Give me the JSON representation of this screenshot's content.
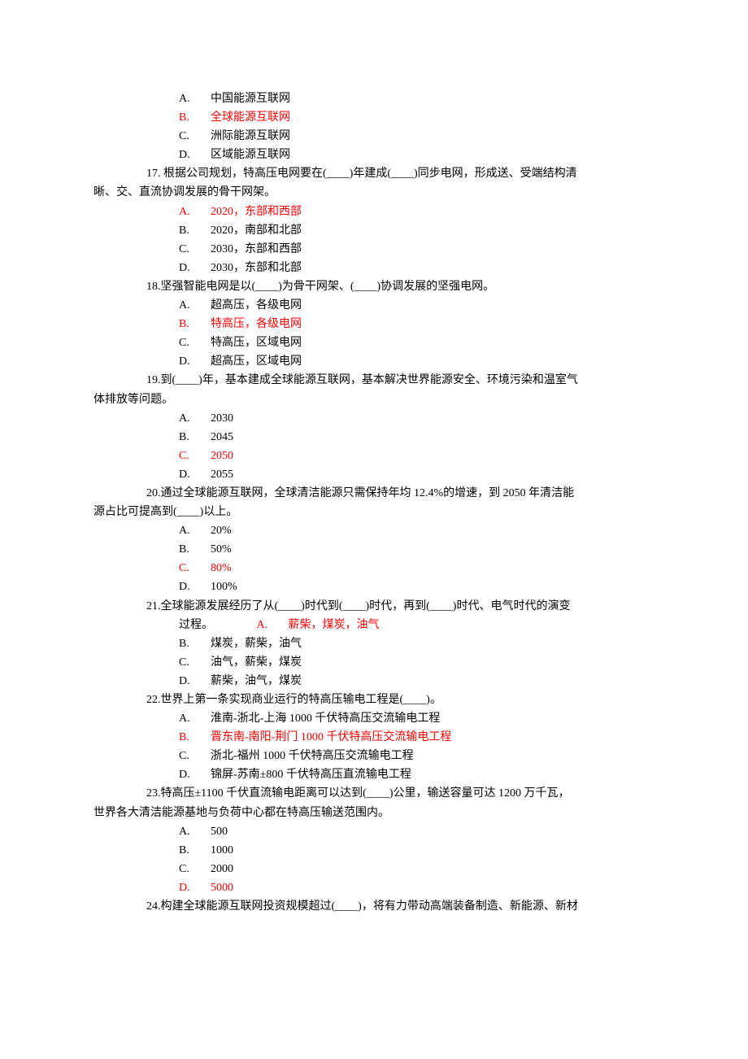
{
  "q16": {
    "a": {
      "letter": "A.",
      "text": "中国能源互联网"
    },
    "b": {
      "letter": "B.",
      "text": "全球能源互联网"
    },
    "c": {
      "letter": "C.",
      "text": "洲际能源互联网"
    },
    "d": {
      "letter": "D.",
      "text": "区域能源互联网"
    }
  },
  "q17": {
    "stem1": "17. 根据公司规划，特高压电网要在(____)年建成(____)同步电网，形成送、受端结构清",
    "stem2": "晰、交、直流协调发展的骨干网架。",
    "a": {
      "letter": "A.",
      "text": "2020，东部和西部"
    },
    "b": {
      "letter": "B.",
      "text": "2020，南部和北部"
    },
    "c": {
      "letter": "C.",
      "text": "2030，东部和西部"
    },
    "d": {
      "letter": "D.",
      "text": "2030，东部和北部"
    }
  },
  "q18": {
    "stem": "18.坚强智能电网是以(____)为骨干网架、(____)协调发展的坚强电网。",
    "a": {
      "letter": "A.",
      "text": "超高压，各级电网"
    },
    "b": {
      "letter": "B.",
      "text": "特高压，各级电网"
    },
    "c": {
      "letter": "C.",
      "text": "特高压，区域电网"
    },
    "d": {
      "letter": "D.",
      "text": "超高压，区域电网"
    }
  },
  "q19": {
    "stem1": "19.到(____)年，基本建成全球能源互联网，基本解决世界能源安全、环境污染和温室气",
    "stem2": "体排放等问题。",
    "a": {
      "letter": "A.",
      "text": "2030"
    },
    "b": {
      "letter": "B.",
      "text": "2045"
    },
    "c": {
      "letter": "C.",
      "text": "2050"
    },
    "d": {
      "letter": "D.",
      "text": "2055"
    }
  },
  "q20": {
    "stem1": "20.通过全球能源互联网，全球清洁能源只需保持年均 12.4%的增速，到 2050 年清洁能",
    "stem2": "源占比可提高到(____)以上。",
    "a": {
      "letter": "A.",
      "text": "20%"
    },
    "b": {
      "letter": "B.",
      "text": "50%"
    },
    "c": {
      "letter": "C.",
      "text": "80%"
    },
    "d": {
      "letter": "D.",
      "text": "100%"
    }
  },
  "q21": {
    "stem1": "21.全球能源发展经历了从(____)时代到(____)时代，再到(____)时代、电气时代的演变",
    "stem2a": "过程。",
    "a": {
      "letter": "A.",
      "text": "薪柴，煤炭，油气"
    },
    "b": {
      "letter": "B.",
      "text": "煤炭，薪柴，油气"
    },
    "c": {
      "letter": "C.",
      "text": "油气，薪柴，煤炭"
    },
    "d": {
      "letter": "D.",
      "text": "薪柴，油气，煤炭"
    }
  },
  "q22": {
    "stem": "22.世界上第一条实现商业运行的特高压输电工程是(____)。",
    "a": {
      "letter": "A.",
      "text": "淮南-浙北-上海 1000 千伏特高压交流输电工程"
    },
    "b": {
      "letter": "B.",
      "text": "晋东南-南阳-荆门 1000 千伏特高压交流输电工程"
    },
    "c": {
      "letter": "C.",
      "text": "浙北-福州 1000 千伏特高压交流输电工程"
    },
    "d": {
      "letter": "D.",
      "text": "锦屏-苏南±800 千伏特高压直流输电工程"
    }
  },
  "q23": {
    "stem1": "23.特高压±1100 千伏直流输电距离可以达到(____)公里，输送容量可达 1200 万千瓦，",
    "stem2": "世界各大清洁能源基地与负荷中心都在特高压输送范围内。",
    "a": {
      "letter": "A.",
      "text": "500"
    },
    "b": {
      "letter": "B.",
      "text": "1000"
    },
    "c": {
      "letter": "C.",
      "text": "2000"
    },
    "d": {
      "letter": "D.",
      "text": "5000"
    }
  },
  "q24": {
    "stem": "24.构建全球能源互联网投资规模超过(____)，将有力带动高端装备制造、新能源、新材"
  }
}
